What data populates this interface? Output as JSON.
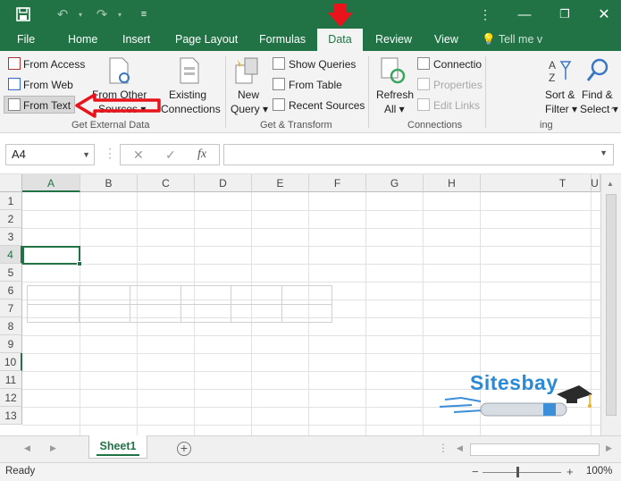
{
  "colors": {
    "brand": "#217346",
    "annotation": "#e8131b"
  },
  "ribbon_tabs": [
    {
      "label": "File"
    },
    {
      "label": "Home"
    },
    {
      "label": "Insert"
    },
    {
      "label": "Page Layout"
    },
    {
      "label": "Formulas"
    },
    {
      "label": "Data",
      "active": true
    },
    {
      "label": "Review"
    },
    {
      "label": "View"
    }
  ],
  "tell_me": "Tell me v",
  "get_external_data": {
    "from_access": "From Access",
    "from_web": "From Web",
    "from_text": "From Text",
    "from_other_line1": "From Other",
    "from_other_line2": "Sources",
    "existing_line1": "Existing",
    "existing_line2": "Connections",
    "label": "Get External Data"
  },
  "get_transform": {
    "new_query_line1": "New",
    "new_query_line2": "Query",
    "show_queries": "Show Queries",
    "from_table": "From Table",
    "recent_sources": "Recent Sources",
    "label": "Get & Transform"
  },
  "connections": {
    "refresh_line1": "Refresh",
    "refresh_line2": "All",
    "connections": "Connectio",
    "properties": "Properties",
    "edit_links": "Edit Links",
    "label": "Connections"
  },
  "sort_filter": {
    "sort_line1": "Sort &",
    "sort_line2": "Filter",
    "find_line1": "Find &",
    "find_line2": "Select",
    "label": "ing"
  },
  "formula_bar": {
    "name_box": "A4",
    "fx": "fx",
    "value": ""
  },
  "columns": [
    "A",
    "B",
    "C",
    "D",
    "E",
    "F",
    "G",
    "H",
    "T",
    "U"
  ],
  "rows": [
    "1",
    "2",
    "3",
    "4",
    "5",
    "6",
    "7",
    "8",
    "9",
    "10",
    "11",
    "12",
    "13"
  ],
  "active_cell": "A4",
  "watermark": "Sitesbay",
  "sheets": [
    "Sheet1"
  ],
  "status": {
    "text": "Ready",
    "zoom": "100%"
  }
}
